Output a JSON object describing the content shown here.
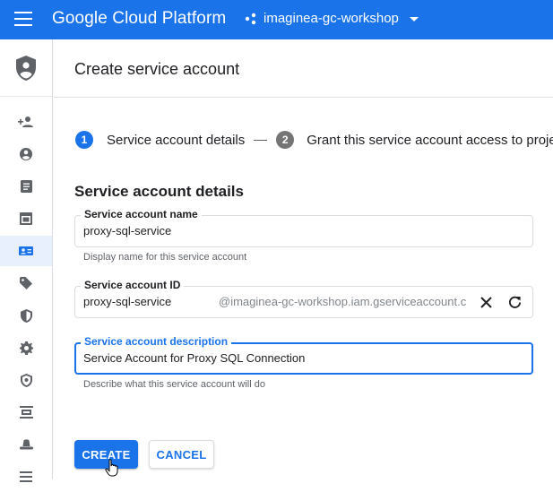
{
  "topbar": {
    "brand": "Google Cloud Platform",
    "project": "imaginea-gc-workshop",
    "color": "#1a73e8"
  },
  "rail": {
    "header_icon": "iam-shield-icon",
    "items": [
      {
        "icon": "person-add-icon"
      },
      {
        "icon": "account-circle-icon"
      },
      {
        "icon": "document-icon"
      },
      {
        "icon": "calendar-icon"
      },
      {
        "icon": "service-account-icon",
        "active": true
      },
      {
        "icon": "label-icon"
      },
      {
        "icon": "security-shield-icon"
      },
      {
        "icon": "settings-gear-icon"
      },
      {
        "icon": "security-policy-icon"
      },
      {
        "icon": "list-view-icon"
      },
      {
        "icon": "hat-icon"
      },
      {
        "icon": "menu-lines-icon"
      }
    ]
  },
  "header": {
    "title": "Create service account"
  },
  "stepper": {
    "step1": {
      "number": "1",
      "label": "Service account details"
    },
    "step2": {
      "number": "2",
      "label": "Grant this service account access to proje"
    }
  },
  "form": {
    "section_title": "Service account details",
    "name": {
      "label": "Service account name",
      "value": "proxy-sql-service",
      "hint": "Display name for this service account"
    },
    "id": {
      "label": "Service account ID",
      "value": "proxy-sql-service",
      "suffix": "@imaginea-gc-workshop.iam.gserviceaccount.c"
    },
    "description": {
      "label": "Service account description",
      "value": "Service Account for Proxy SQL Connection",
      "hint": "Describe what this service account will do"
    }
  },
  "actions": {
    "create": "CREATE",
    "cancel": "CANCEL"
  }
}
